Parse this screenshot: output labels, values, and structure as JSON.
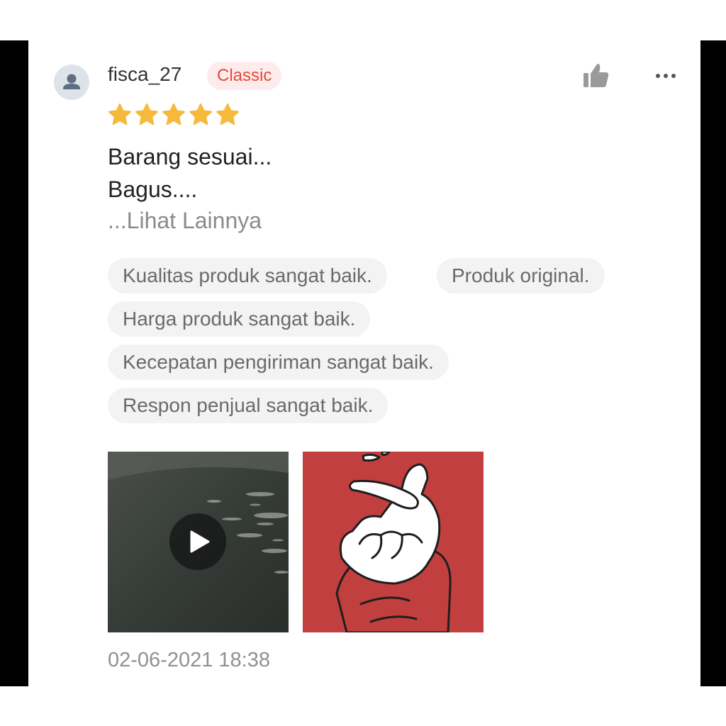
{
  "review": {
    "username": "fisca_27",
    "badge": "Classic",
    "rating": 5,
    "rating_max": 5,
    "text_lines": [
      "Barang sesuai...",
      "Bagus...."
    ],
    "see_more": "...Lihat Lainnya",
    "tags": [
      "Kualitas produk sangat baik.",
      "Produk original.",
      "Harga produk sangat baik.",
      "Kecepatan pengiriman sangat baik.",
      "Respon penjual sangat baik."
    ],
    "media": [
      {
        "type": "video",
        "icon": "play-icon"
      },
      {
        "type": "image",
        "icon": "finger-heart-icon"
      }
    ],
    "timestamp": "02-06-2021 18:38"
  },
  "icons": {
    "avatar": "user-avatar-icon",
    "like": "thumbs-up-icon",
    "more": "more-horizontal-icon",
    "star": "star-icon"
  },
  "colors": {
    "badge_text": "#e8483a",
    "badge_bg": "#fdeceb",
    "star": "#f6b93b",
    "tag_bg": "#f3f3f3",
    "image_bg": "#c13f3f"
  }
}
